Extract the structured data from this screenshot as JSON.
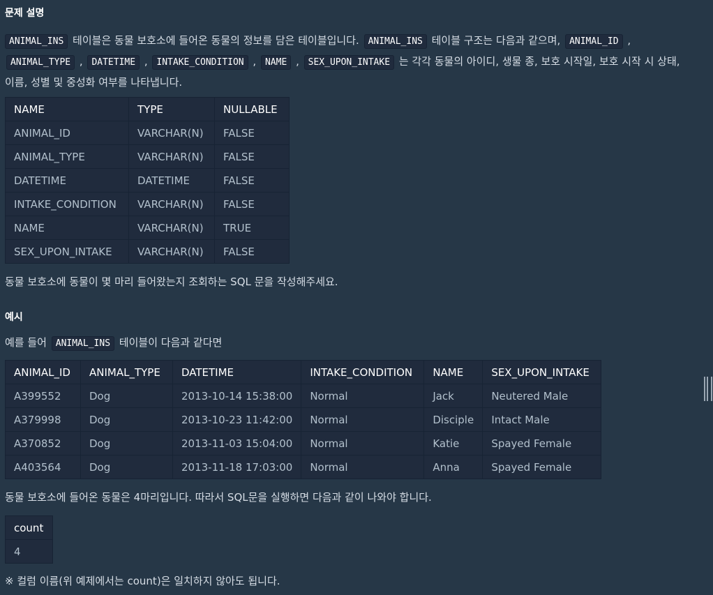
{
  "section_title": "문제 설명",
  "intro": {
    "c1": "ANIMAL_INS",
    "t1": " 테이블은 동물 보호소에 들어온 동물의 정보를 담은 테이블입니다. ",
    "c2": "ANIMAL_INS",
    "t2": " 테이블 구조는 다음과 같으며, ",
    "cols": [
      "ANIMAL_ID",
      "ANIMAL_TYPE",
      "DATETIME",
      "INTAKE_CONDITION",
      "NAME",
      "SEX_UPON_INTAKE"
    ],
    "sep": ",",
    "t3": " 는 각각 동물의 아이디, 생물 종, 보호 시작일, 보호 시작 시 상태, 이름, 성별 및 중성화 여부를 나타냅니다."
  },
  "schema_table": {
    "headers": [
      "NAME",
      "TYPE",
      "NULLABLE"
    ],
    "rows": [
      [
        "ANIMAL_ID",
        "VARCHAR(N)",
        "FALSE"
      ],
      [
        "ANIMAL_TYPE",
        "VARCHAR(N)",
        "FALSE"
      ],
      [
        "DATETIME",
        "DATETIME",
        "FALSE"
      ],
      [
        "INTAKE_CONDITION",
        "VARCHAR(N)",
        "FALSE"
      ],
      [
        "NAME",
        "VARCHAR(N)",
        "TRUE"
      ],
      [
        "SEX_UPON_INTAKE",
        "VARCHAR(N)",
        "FALSE"
      ]
    ]
  },
  "question": "동물 보호소에 동물이 몇 마리 들어왔는지 조회하는 SQL 문을 작성해주세요.",
  "example_title": "예시",
  "example_intro": {
    "t1": "예를 들어 ",
    "code": "ANIMAL_INS",
    "t2": " 테이블이 다음과 같다면"
  },
  "example_table": {
    "headers": [
      "ANIMAL_ID",
      "ANIMAL_TYPE",
      "DATETIME",
      "INTAKE_CONDITION",
      "NAME",
      "SEX_UPON_INTAKE"
    ],
    "rows": [
      [
        "A399552",
        "Dog",
        "2013-10-14 15:38:00",
        "Normal",
        "Jack",
        "Neutered Male"
      ],
      [
        "A379998",
        "Dog",
        "2013-10-23 11:42:00",
        "Normal",
        "Disciple",
        "Intact Male"
      ],
      [
        "A370852",
        "Dog",
        "2013-11-03 15:04:00",
        "Normal",
        "Katie",
        "Spayed Female"
      ],
      [
        "A403564",
        "Dog",
        "2013-11-18 17:03:00",
        "Normal",
        "Anna",
        "Spayed Female"
      ]
    ]
  },
  "result_text": "동물 보호소에 들어온 동물은 4마리입니다. 따라서 SQL문을 실행하면 다음과 같이 나와야 합니다.",
  "result_table": {
    "headers": [
      "count"
    ],
    "rows": [
      [
        "4"
      ]
    ]
  },
  "note": "※ 컬럼 이름(위 예제에서는 count)은 일치하지 않아도 됩니다."
}
